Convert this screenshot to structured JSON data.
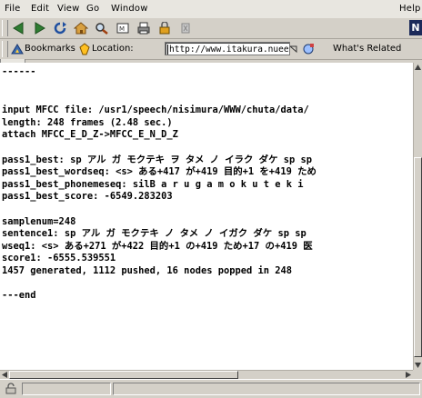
{
  "menubar": {
    "items": [
      "File",
      "Edit",
      "View",
      "Go",
      "Window"
    ],
    "help": "Help"
  },
  "toolbar": {
    "buttons": [
      "back-icon",
      "forward-icon",
      "reload-icon",
      "home-icon",
      "search-icon",
      "my-netscape-icon",
      "print-icon",
      "security-icon",
      "stop-icon"
    ],
    "logo": "N"
  },
  "location_bar": {
    "bookmarks_label": "Bookmarks",
    "location_label": "Location:",
    "url": "http://www.itakura.nuee.",
    "whats_related": "What's Related"
  },
  "content": {
    "top_partial": "------",
    "lines": [
      "",
      "",
      "input MFCC file: /usr1/speech/nisimura/WWW/chuta/data/",
      "length: 248 frames (2.48 sec.)",
      "attach MFCC_E_D_Z->MFCC_E_N_D_Z",
      "",
      "pass1_best: sp アル ガ モクテキ ヲ タメ ノ イラク ダケ sp sp",
      "pass1_best_wordseq: <s> ある+417 が+419 目的+1 を+419 ため",
      "pass1_best_phonemeseq: silB a r u g a m o k u t e k i",
      "pass1_best_score: -6549.283203",
      "",
      "samplenum=248",
      "sentence1: sp アル ガ モクテキ ノ タメ ノ イガク ダケ sp sp",
      "wseq1: <s> ある+271 が+422 目的+1 の+419 ため+17 の+419 医",
      "score1: -6555.539551",
      "1457 generated, 1112 pushed, 16 nodes popped in 248",
      "",
      "---end"
    ]
  }
}
